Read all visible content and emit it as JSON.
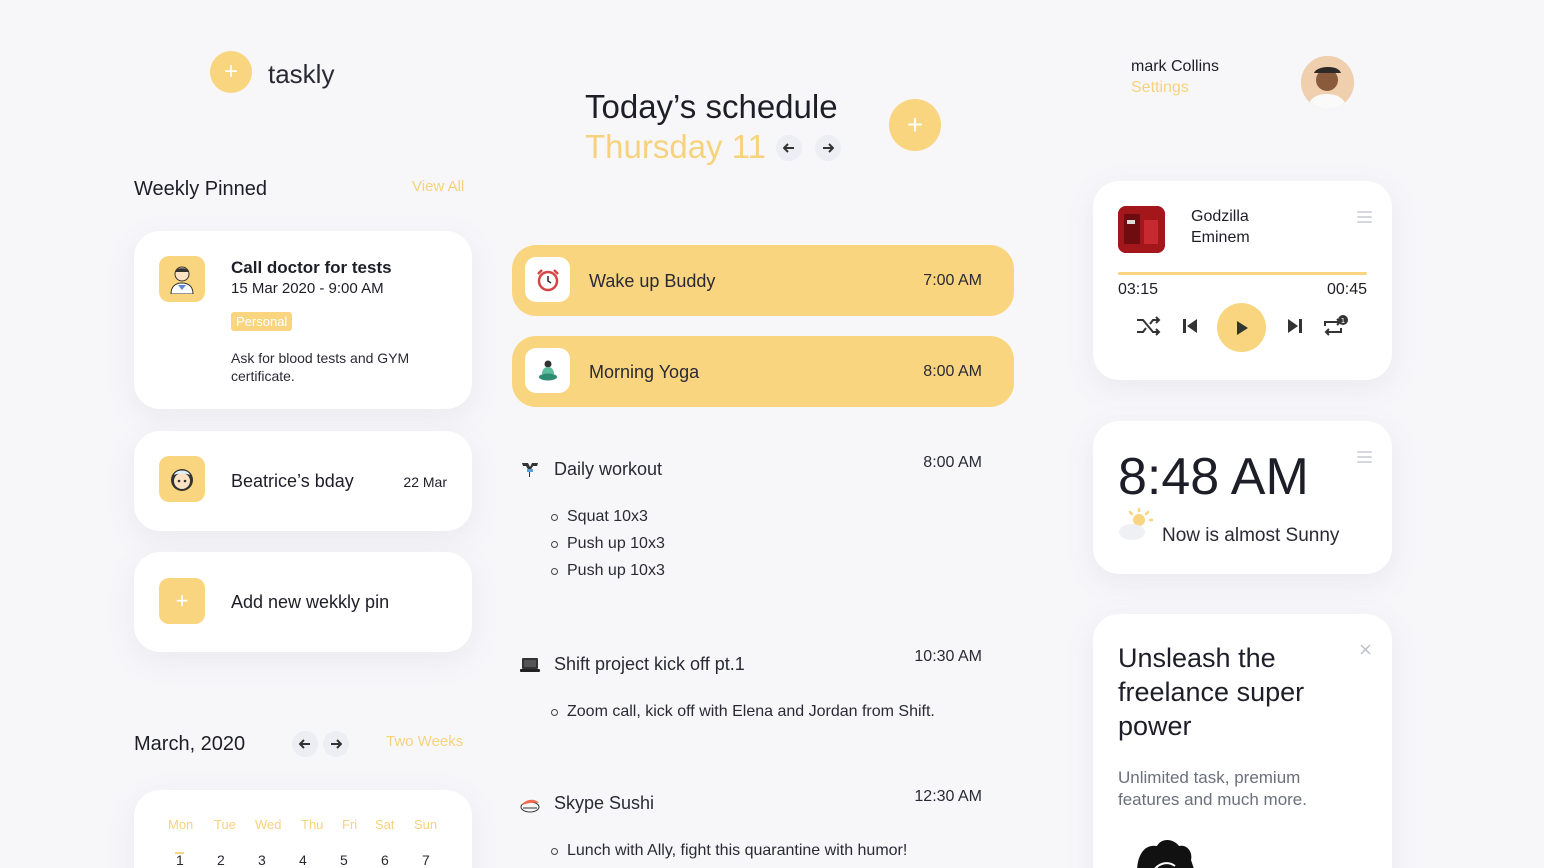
{
  "app": {
    "name": "taskly"
  },
  "header": {
    "title": "Today’s schedule",
    "date": "Thursday 11"
  },
  "user": {
    "name": "mark Collins",
    "settings_label": "Settings"
  },
  "pinned": {
    "title": "Weekly Pinned",
    "view_all": "View All",
    "cards": [
      {
        "title": "Call doctor for tests",
        "datetime": "15 Mar 2020 - 9:00 AM",
        "tag": "Personal",
        "note": "Ask for blood tests and GYM certificate."
      },
      {
        "title": "Beatrice’s bday",
        "date": "22 Mar"
      }
    ],
    "add_label": "Add new wekkly pin"
  },
  "calendar": {
    "month": "March, 2020",
    "view_toggle": "Two Weeks",
    "days": [
      "Mon",
      "Tue",
      "Wed",
      "Thu",
      "Fri",
      "Sat",
      "Sun"
    ],
    "dates": [
      "1",
      "2",
      "3",
      "4",
      "5",
      "6",
      "7"
    ]
  },
  "schedule": {
    "highlighted": [
      {
        "title": "Wake up Buddy",
        "time": "7:00 AM",
        "icon": "alarm-clock-icon"
      },
      {
        "title": "Morning Yoga",
        "time": "8:00 AM",
        "icon": "meditation-icon"
      }
    ],
    "tasks": [
      {
        "title": "Daily workout",
        "time": "8:00 AM",
        "icon": "dumbbell-icon",
        "items": [
          "Squat 10x3",
          "Push up 10x3",
          "Push up 10x3"
        ]
      },
      {
        "title": "Shift project kick off pt.1",
        "time": "10:30 AM",
        "icon": "laptop-icon",
        "items": [
          "Zoom call, kick off with Elena and Jordan from Shift."
        ]
      },
      {
        "title": "Skype Sushi",
        "time": "12:30 AM",
        "icon": "sushi-icon",
        "items": [
          "Lunch with Ally, fight this quarantine with humor!"
        ]
      }
    ]
  },
  "player": {
    "song": "Godzilla",
    "artist": "Eminem",
    "elapsed": "03:15",
    "remaining": "00:45",
    "progress": 1.0
  },
  "weather": {
    "time": "8:48 AM",
    "description": "Now is almost Sunny"
  },
  "promo": {
    "headline": "Unsleash the freelance super power",
    "body": "Unlimited task, premium features and much more."
  },
  "colors": {
    "accent": "#f9d57f",
    "accent_text": "#f7d27c",
    "background": "#f7f7fa",
    "text": "#1e1e28"
  }
}
